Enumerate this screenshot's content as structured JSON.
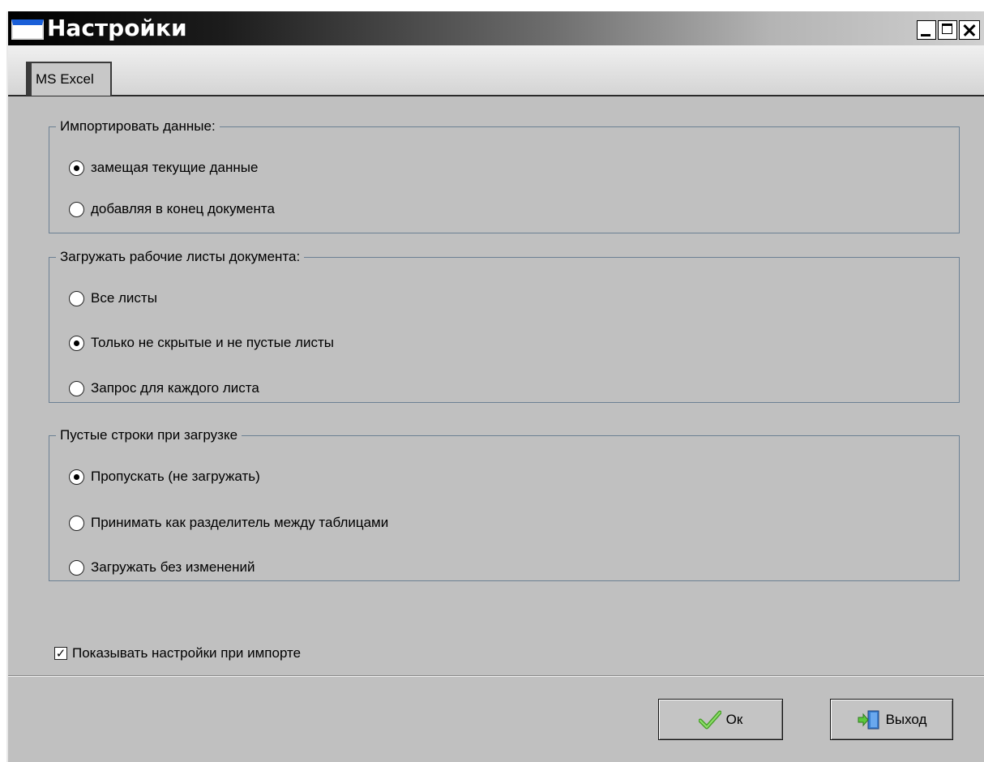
{
  "window": {
    "title": "Настройки"
  },
  "tabs": [
    {
      "label": "MS Excel",
      "active": true
    }
  ],
  "groups": {
    "import": {
      "legend": "Импортировать данные:",
      "options": [
        {
          "label": "замещая текущие данные",
          "selected": true
        },
        {
          "label": "добавляя в конец документа",
          "selected": false
        }
      ]
    },
    "sheets": {
      "legend": "Загружать рабочие листы документа:",
      "options": [
        {
          "label": "Все листы",
          "selected": false
        },
        {
          "label": "Только не скрытые и не пустые листы",
          "selected": true
        },
        {
          "label": "Запрос для каждого листа",
          "selected": false
        }
      ]
    },
    "empty_rows": {
      "legend": "Пустые строки при загрузке",
      "options": [
        {
          "label": "Пропускать (не загружать)",
          "selected": true
        },
        {
          "label": "Принимать как разделитель между таблицами",
          "selected": false
        },
        {
          "label": "Загружать без изменений",
          "selected": false
        }
      ]
    }
  },
  "show_settings": {
    "label": "Показывать настройки при импорте",
    "checked": true
  },
  "buttons": {
    "ok_label": "Ок",
    "exit_label": "Выход"
  },
  "colors": {
    "group_border": "#6b8093",
    "panel_bg": "#c0c0c0",
    "ok_icon": "#5cc83c",
    "exit_icon": "#3a7fd0"
  }
}
